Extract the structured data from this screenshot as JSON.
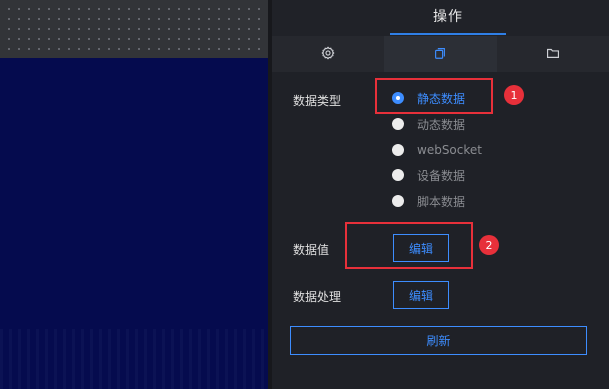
{
  "panel": {
    "title": "操作",
    "icon_tabs": [
      {
        "icon": "gear-icon"
      },
      {
        "icon": "copy-icon"
      },
      {
        "icon": "folder-icon"
      }
    ]
  },
  "data_type": {
    "label": "数据类型",
    "options": [
      {
        "label": "静态数据",
        "checked": true
      },
      {
        "label": "动态数据",
        "checked": false
      },
      {
        "label": "webSocket",
        "checked": false
      },
      {
        "label": "设备数据",
        "checked": false
      },
      {
        "label": "脚本数据",
        "checked": false
      }
    ]
  },
  "data_value": {
    "label": "数据值",
    "button": "编辑"
  },
  "data_process": {
    "label": "数据处理",
    "button": "编辑"
  },
  "refresh_button": "刷新",
  "annotations": [
    "1",
    "2"
  ],
  "colors": {
    "accent": "#3d8dff",
    "annotation": "#e7303a",
    "canvas_bg": "#050b4e",
    "panel_bg": "#1f2127"
  }
}
